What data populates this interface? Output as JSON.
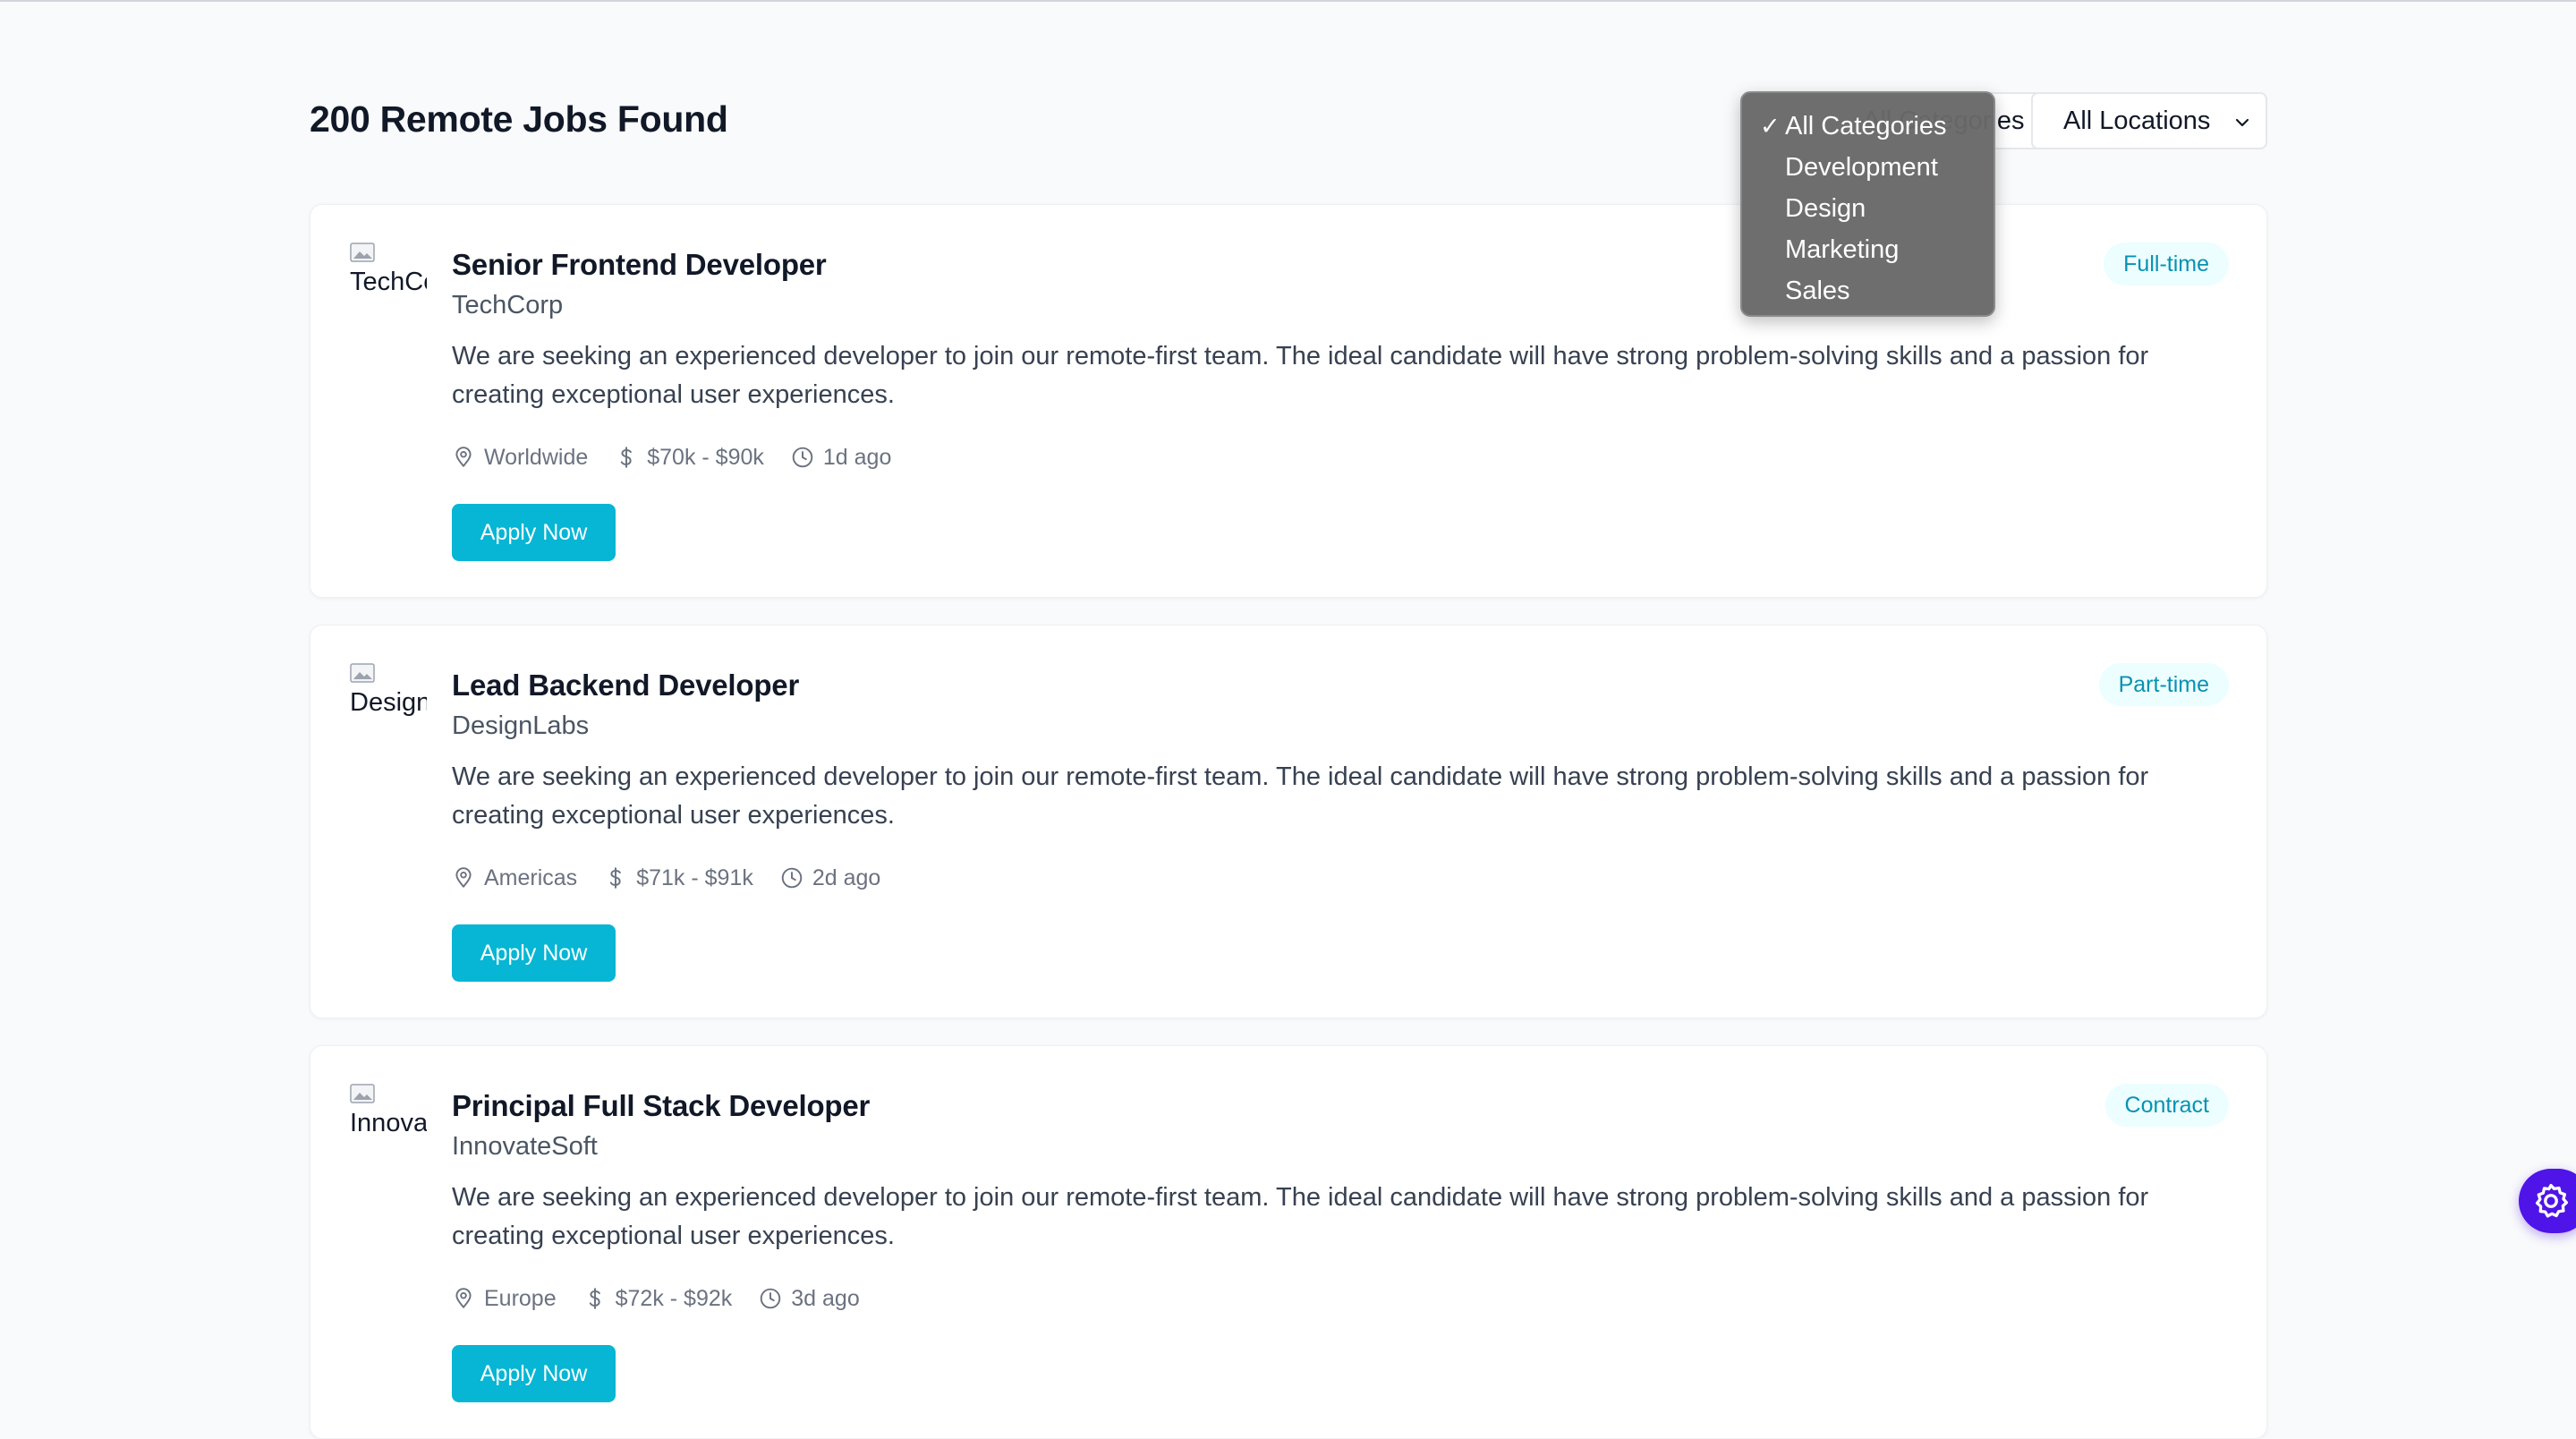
{
  "header": {
    "title": "200 Remote Jobs Found",
    "category_select": {
      "selected": "All Categories",
      "options": [
        "All Categories",
        "Development",
        "Design",
        "Marketing",
        "Sales"
      ]
    },
    "location_select": {
      "selected": "All Locations"
    }
  },
  "jobs": [
    {
      "title": "Senior Frontend Developer",
      "company": "TechCorp",
      "logo_alt": "TechCorp",
      "type": "Full-time",
      "description": "We are seeking an experienced developer to join our remote-first team. The ideal candidate will have strong problem-solving skills and a passion for creating exceptional user experiences.",
      "location": "Worldwide",
      "salary": "$70k - $90k",
      "posted": "1d ago",
      "apply_label": "Apply Now"
    },
    {
      "title": "Lead Backend Developer",
      "company": "DesignLabs",
      "logo_alt": "DesignLabs",
      "type": "Part-time",
      "description": "We are seeking an experienced developer to join our remote-first team. The ideal candidate will have strong problem-solving skills and a passion for creating exceptional user experiences.",
      "location": "Americas",
      "salary": "$71k - $91k",
      "posted": "2d ago",
      "apply_label": "Apply Now"
    },
    {
      "title": "Principal Full Stack Developer",
      "company": "InnovateSoft",
      "logo_alt": "InnovateSoft",
      "type": "Contract",
      "description": "We are seeking an experienced developer to join our remote-first team. The ideal candidate will have strong problem-solving skills and a passion for creating exceptional user experiences.",
      "location": "Europe",
      "salary": "$72k - $92k",
      "posted": "3d ago",
      "apply_label": "Apply Now"
    }
  ],
  "icons": {
    "location": "map-pin-icon",
    "salary": "dollar-icon",
    "posted": "clock-icon",
    "fab": "settings-icon"
  },
  "colors": {
    "accent": "#06b6d4",
    "badge_bg": "#ecfeff",
    "badge_text": "#0891b2",
    "fab": "#4f14e8"
  }
}
